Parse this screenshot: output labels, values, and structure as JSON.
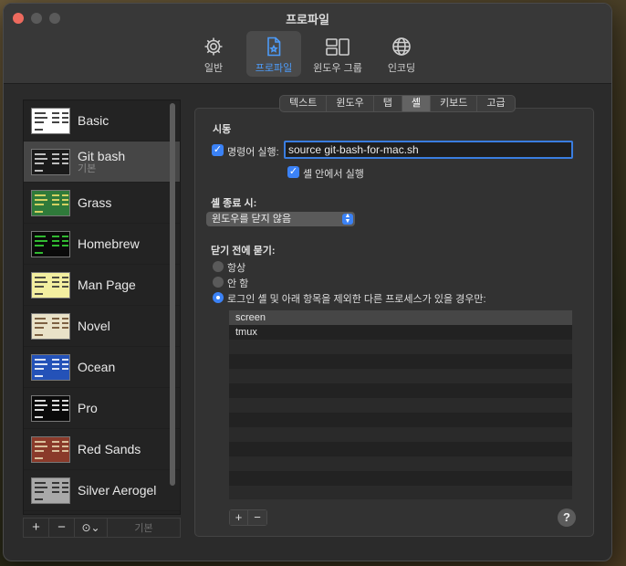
{
  "window": {
    "title": "프로파일"
  },
  "toolbar": {
    "items": [
      {
        "label": "일반",
        "icon": "gear-icon"
      },
      {
        "label": "프로파일",
        "icon": "profile-doc-icon"
      },
      {
        "label": "윈도우 그룹",
        "icon": "window-group-icon"
      },
      {
        "label": "인코딩",
        "icon": "globe-icon"
      }
    ],
    "active_color": "#4d9bf8"
  },
  "sidebar": {
    "profiles": [
      {
        "name": "Basic",
        "sub": "",
        "bg": "#ffffff",
        "fg": "#222222"
      },
      {
        "name": "Git bash",
        "sub": "기본",
        "bg": "#1a1a1a",
        "fg": "#dcdcdc"
      },
      {
        "name": "Grass",
        "sub": "",
        "bg": "#2f7a3a",
        "fg": "#f0e06a"
      },
      {
        "name": "Homebrew",
        "sub": "",
        "bg": "#0a0a0a",
        "fg": "#38d838"
      },
      {
        "name": "Man Page",
        "sub": "",
        "bg": "#f3efa0",
        "fg": "#333333"
      },
      {
        "name": "Novel",
        "sub": "",
        "bg": "#e9e2c8",
        "fg": "#6a4a2a"
      },
      {
        "name": "Ocean",
        "sub": "",
        "bg": "#2452b8",
        "fg": "#ffffff"
      },
      {
        "name": "Pro",
        "sub": "",
        "bg": "#0a0a0a",
        "fg": "#ffffff"
      },
      {
        "name": "Red Sands",
        "sub": "",
        "bg": "#8a3a2a",
        "fg": "#e8d8b0"
      },
      {
        "name": "Silver Aerogel",
        "sub": "",
        "bg": "#a9a9a9",
        "fg": "#222222"
      }
    ],
    "footer": {
      "add": "+",
      "remove": "−",
      "menu": "⊙⌄",
      "default_label": "기본"
    }
  },
  "tabs": [
    "텍스트",
    "윈도우",
    "탭",
    "셸",
    "키보드",
    "고급"
  ],
  "shell": {
    "startup_title": "시동",
    "run_command_label": "명령어 실행:",
    "run_command_checked": true,
    "command_value": "source git-bash-for-mac.sh",
    "run_in_shell_label": "셸 안에서 실행",
    "run_in_shell_checked": true,
    "on_exit_title": "셸 종료 시:",
    "on_exit_value": "윈도우를 닫지 않음",
    "ask_title": "닫기 전에 묻기:",
    "ask_options": [
      "항상",
      "안 함",
      "로그인 셸 및 아래 항목을 제외한 다른 프로세스가 있을 경우만:"
    ],
    "ask_selected": 2,
    "processes": [
      "screen",
      "tmux"
    ],
    "add_btn": "+",
    "remove_btn": "−",
    "help": "?"
  },
  "colors": {
    "accent": "#3b82f6",
    "close": "#ed6a5e"
  }
}
